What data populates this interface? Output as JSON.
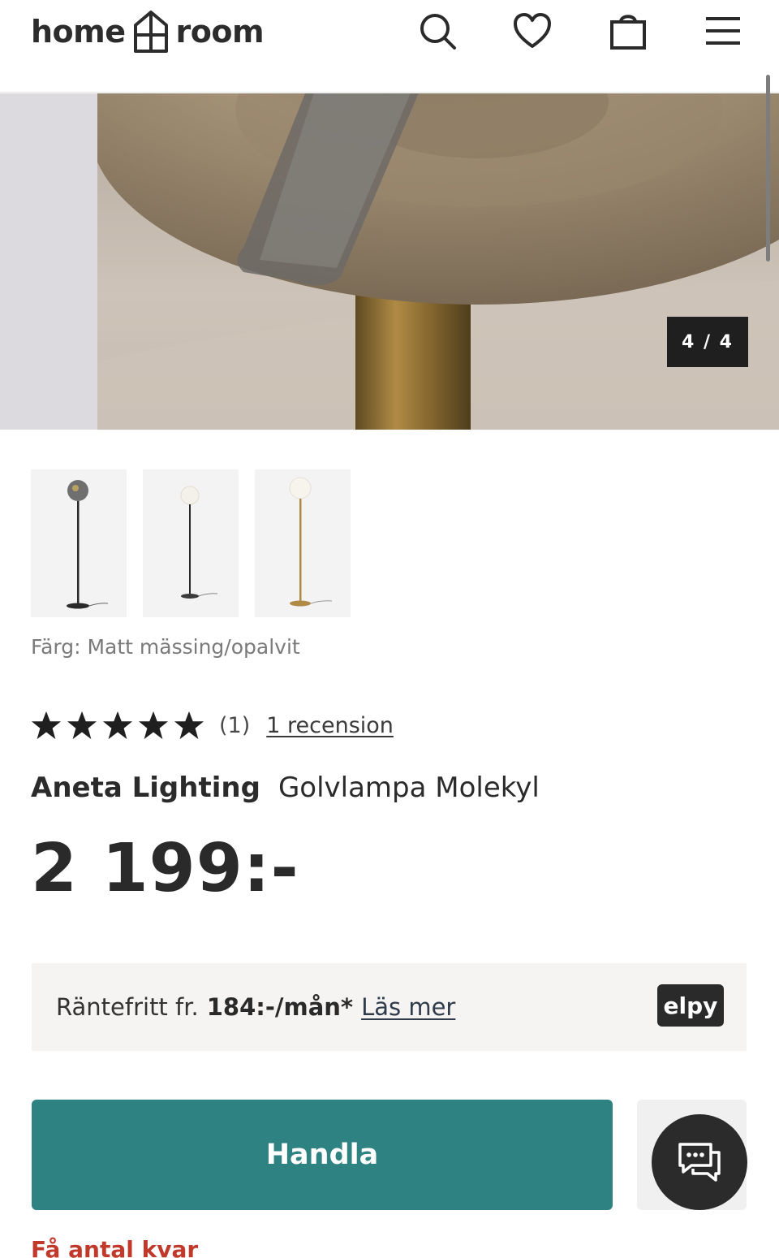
{
  "header": {
    "logo_left": "home",
    "logo_right": "room",
    "icons": [
      "search-icon",
      "heart-icon",
      "bag-icon",
      "menu-icon"
    ]
  },
  "gallery": {
    "counter": "4 / 4",
    "thumbnails": [
      {
        "name": "Smoke/black variant"
      },
      {
        "name": "Black/opal variant"
      },
      {
        "name": "Brass/opal variant"
      }
    ]
  },
  "product": {
    "color_label": "Färg: Matt mässing/opalvit",
    "rating": {
      "stars": 5,
      "count": "(1)",
      "review_link": "1 recension"
    },
    "brand": "Aneta Lighting",
    "name": "Golvlampa Molekyl",
    "price": "2 199:-"
  },
  "financing": {
    "prefix": "Räntefritt fr.",
    "amount": "184:-/mån*",
    "link": "Läs mer",
    "provider": "elpy"
  },
  "actions": {
    "buy_label": "Handla",
    "stock_text": "Få antal kvar"
  },
  "colors": {
    "accent": "#2e8282",
    "text": "#2a2a2a",
    "warning": "#c0392b"
  }
}
